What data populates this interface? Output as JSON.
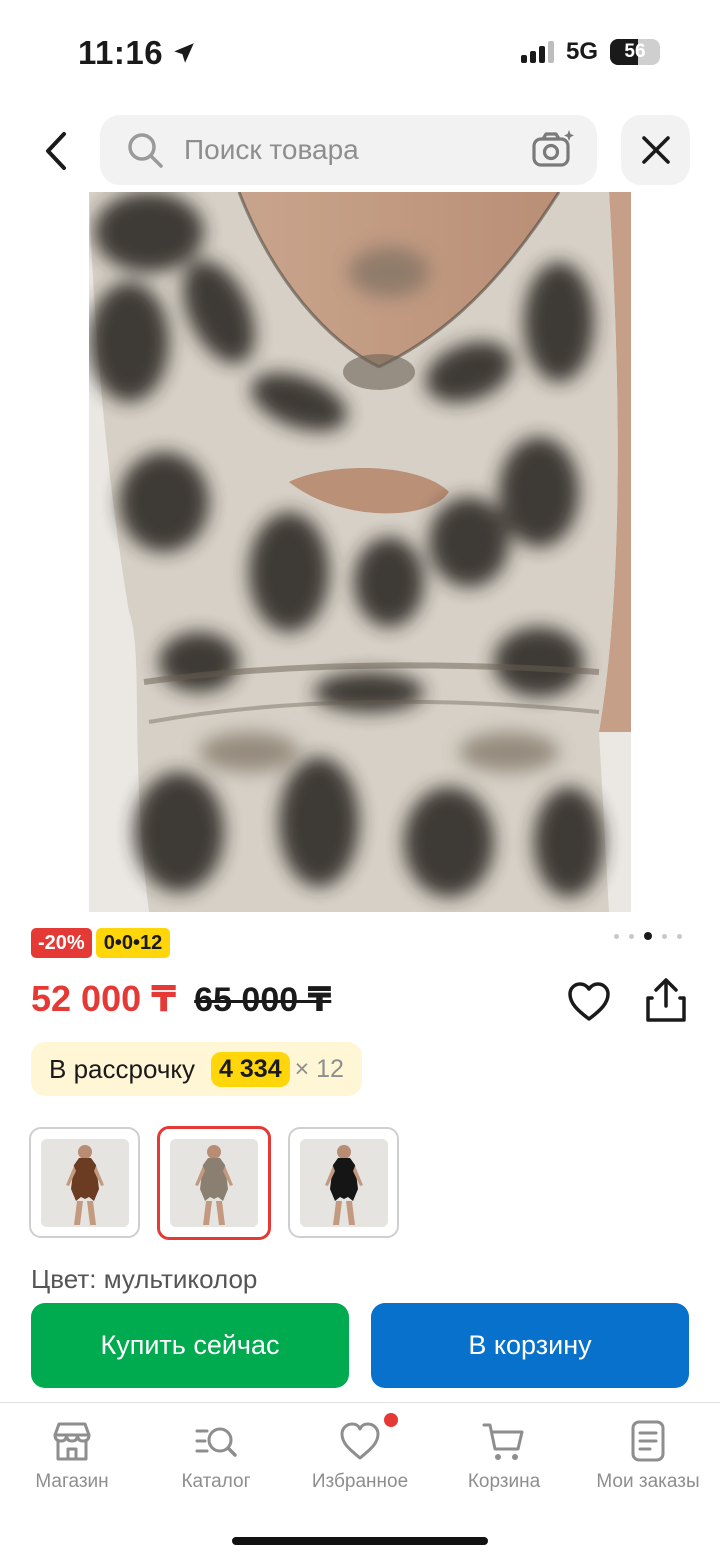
{
  "status_bar": {
    "time": "11:16",
    "network": "5G",
    "battery_level": "56"
  },
  "search": {
    "placeholder": "Поиск товара"
  },
  "badges": {
    "discount": "-20%",
    "installment_plan": "0•0•12"
  },
  "gallery": {
    "total_images": 5,
    "active_index": 2
  },
  "price": {
    "current": "52 000 ₸",
    "old": "65 000 ₸"
  },
  "installment": {
    "label": "В рассрочку",
    "amount": "4 334",
    "multiplier": "× 12"
  },
  "variants": [
    {
      "color": "#6b3b22",
      "selected": false
    },
    {
      "color": "#8a7f70",
      "selected": true
    },
    {
      "color": "#151515",
      "selected": false
    }
  ],
  "color_info": {
    "text": "Цвет: мультиколор"
  },
  "actions": {
    "buy_now": "Купить сейчас",
    "add_to_cart": "В корзину"
  },
  "tab_bar": {
    "items": [
      {
        "label": "Магазин",
        "icon": "store-icon"
      },
      {
        "label": "Каталог",
        "icon": "catalog-search-icon"
      },
      {
        "label": "Избранное",
        "icon": "heart-icon",
        "notification": true
      },
      {
        "label": "Корзина",
        "icon": "cart-icon"
      },
      {
        "label": "Мои заказы",
        "icon": "orders-icon"
      }
    ]
  },
  "colors": {
    "accent_red": "#e53935",
    "buy_green": "#00ab4f",
    "cart_blue": "#0871cc",
    "badge_yellow": "#ffd60a",
    "installment_bg": "#fff6d6"
  }
}
